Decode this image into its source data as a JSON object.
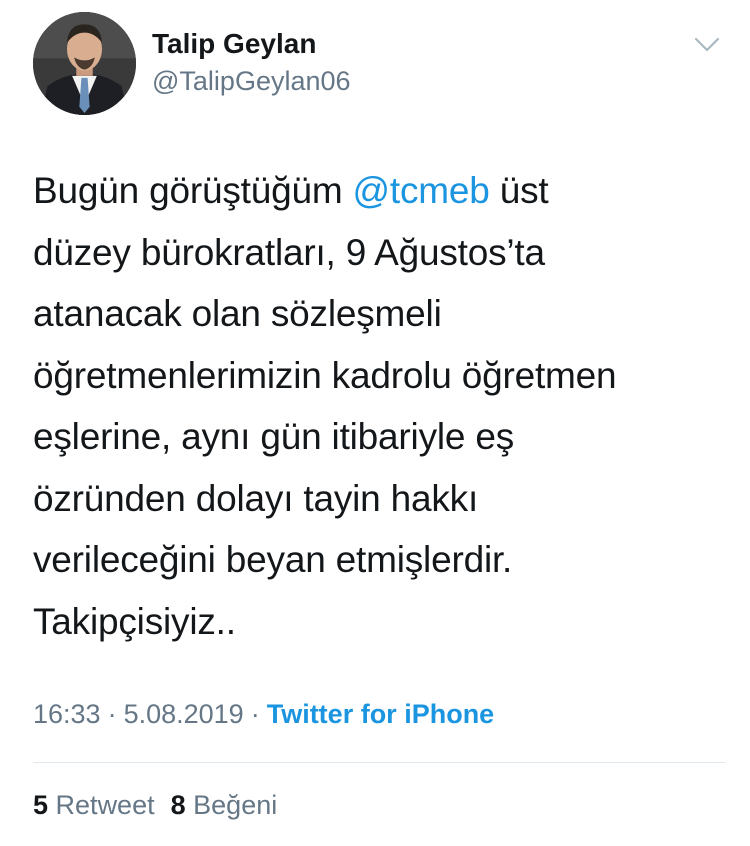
{
  "user": {
    "display_name": "Talip Geylan",
    "handle": "@TalipGeylan06"
  },
  "tweet": {
    "lines": [
      {
        "before": "Bugün görüştüğüm ",
        "mention": "@tcmeb",
        "after": " üst"
      },
      {
        "text": "düzey bürokratları, 9 Ağustos’ta"
      },
      {
        "text": "atanacak olan sözleşmeli"
      },
      {
        "text": "öğretmenlerimizin kadrolu öğretmen"
      },
      {
        "text": "eşlerine, aynı gün itibariyle eş"
      },
      {
        "text": "özründen dolayı tayin hakkı"
      },
      {
        "text": "verileceğini beyan etmişlerdir."
      },
      {
        "text": "Takipçisiyiz.."
      }
    ]
  },
  "meta": {
    "time": "16:33",
    "separator": "·",
    "date": "5.08.2019",
    "source": "Twitter for iPhone"
  },
  "stats": {
    "retweets_count": "5",
    "retweets_label": "Retweet",
    "likes_count": "8",
    "likes_label": "Beğeni"
  },
  "icons": {
    "menu": "chevron-down-icon"
  },
  "colors": {
    "link": "#1b95e0",
    "secondary_text": "#657786",
    "primary_text": "#14171a",
    "divider": "#e1e8ed"
  }
}
